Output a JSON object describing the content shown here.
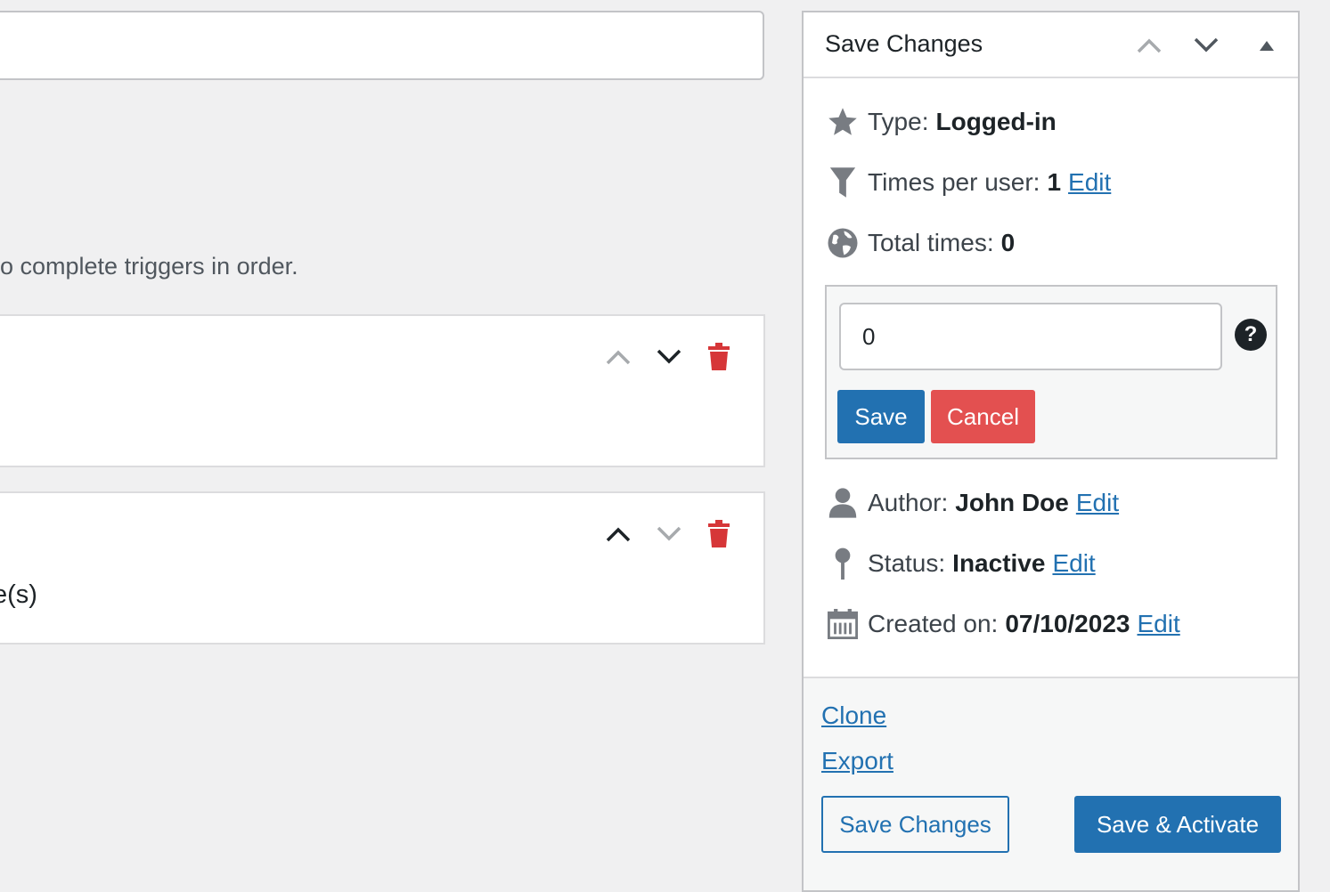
{
  "left": {
    "hint_text": "o complete triggers in order.",
    "triggers": [
      {
        "text": ""
      },
      {
        "text": "e(s)"
      }
    ]
  },
  "panel": {
    "title": "Save Changes",
    "type": {
      "label": "Type:",
      "value": "Logged-in"
    },
    "times_per_user": {
      "label": "Times per user:",
      "value": "1",
      "edit": "Edit"
    },
    "total_times": {
      "label": "Total times:",
      "value": "0"
    },
    "edit_box": {
      "input_value": "0",
      "help": "?",
      "save": "Save",
      "cancel": "Cancel"
    },
    "author": {
      "label": "Author:",
      "value": "John Doe",
      "edit": "Edit"
    },
    "status": {
      "label": "Status:",
      "value": "Inactive",
      "edit": "Edit"
    },
    "created": {
      "label": "Created on:",
      "value": "07/10/2023",
      "edit": "Edit"
    },
    "footer": {
      "clone": "Clone",
      "export": "Export",
      "save_changes": "Save Changes",
      "save_activate": "Save & Activate"
    }
  },
  "colors": {
    "accent": "#2271b1",
    "danger": "#e35050",
    "delete_icon": "#d63638"
  },
  "icons": [
    "chevron-up-icon",
    "chevron-down-icon",
    "trash-icon",
    "caret-up-icon",
    "star-icon",
    "funnel-icon",
    "globe-icon",
    "help-icon",
    "user-icon",
    "pin-icon",
    "calendar-icon"
  ]
}
